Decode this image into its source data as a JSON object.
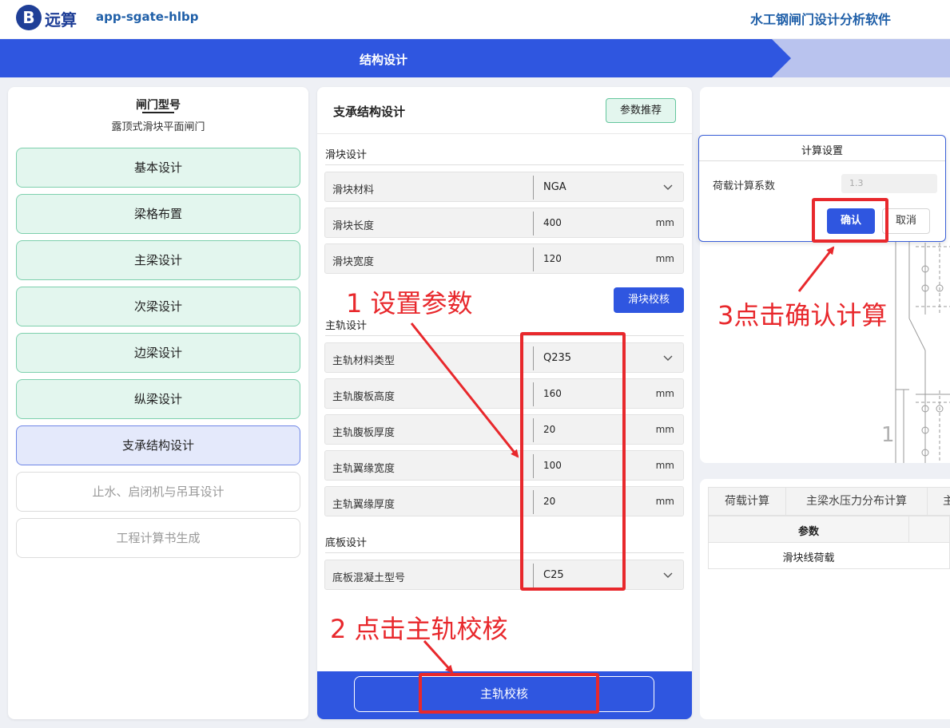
{
  "header": {
    "logo_mark": "B",
    "logo_text": "远算",
    "app_name": "app-sgate-hlbp",
    "product_title": "水工钢闸门设计分析软件"
  },
  "stepbar": {
    "active_step": "结构设计"
  },
  "left_panel": {
    "gate_model_label": "闸门型号",
    "gate_model_value": "露顶式滑块平面闸门",
    "nav": [
      {
        "label": "基本设计",
        "state": "done"
      },
      {
        "label": "梁格布置",
        "state": "done"
      },
      {
        "label": "主梁设计",
        "state": "done"
      },
      {
        "label": "次梁设计",
        "state": "done"
      },
      {
        "label": "边梁设计",
        "state": "done"
      },
      {
        "label": "纵梁设计",
        "state": "done"
      },
      {
        "label": "支承结构设计",
        "state": "current"
      },
      {
        "label": "止水、启闭机与吊耳设计",
        "state": "disabled"
      },
      {
        "label": "工程计算书生成",
        "state": "disabled"
      }
    ]
  },
  "center_panel": {
    "title": "支承结构设计",
    "recommend_button": "参数推荐",
    "slider_section": {
      "title": "滑块设计",
      "fields": [
        {
          "label": "滑块材料",
          "value": "NGA",
          "unit": "",
          "type": "select"
        },
        {
          "label": "滑块长度",
          "value": "400",
          "unit": "mm",
          "type": "input"
        },
        {
          "label": "滑块宽度",
          "value": "120",
          "unit": "mm",
          "type": "input"
        }
      ],
      "check_button": "滑块校核"
    },
    "rail_section": {
      "title": "主轨设计",
      "fields": [
        {
          "label": "主轨材料类型",
          "value": "Q235",
          "unit": "",
          "type": "select"
        },
        {
          "label": "主轨腹板高度",
          "value": "160",
          "unit": "mm",
          "type": "input"
        },
        {
          "label": "主轨腹板厚度",
          "value": "20",
          "unit": "mm",
          "type": "input"
        },
        {
          "label": "主轨翼缘宽度",
          "value": "100",
          "unit": "mm",
          "type": "input"
        },
        {
          "label": "主轨翼缘厚度",
          "value": "20",
          "unit": "mm",
          "type": "input"
        }
      ]
    },
    "base_section": {
      "title": "底板设计",
      "fields": [
        {
          "label": "底板混凝土型号",
          "value": "C25",
          "unit": "",
          "type": "select"
        }
      ]
    },
    "rail_check_button": "主轨校核"
  },
  "modal": {
    "title": "计算设置",
    "field_label": "荷载计算系数",
    "field_value": "1.3",
    "confirm": "确认",
    "cancel": "取消"
  },
  "results_panel": {
    "tabs": [
      "荷载计算",
      "主梁水压力分布计算",
      "主"
    ],
    "table_header": "参数",
    "table_rows": [
      "滑块线荷载"
    ]
  },
  "drawing": {
    "label": "1"
  },
  "annotations": {
    "step1": "1 设置参数",
    "step2": "2 点击主轨校核",
    "step3": "3点击确认计算"
  },
  "colors": {
    "primary": "#2f56e0",
    "done_bg": "#e3f6ee",
    "done_border": "#7dd0ad",
    "annotation_red": "#e8282c"
  }
}
